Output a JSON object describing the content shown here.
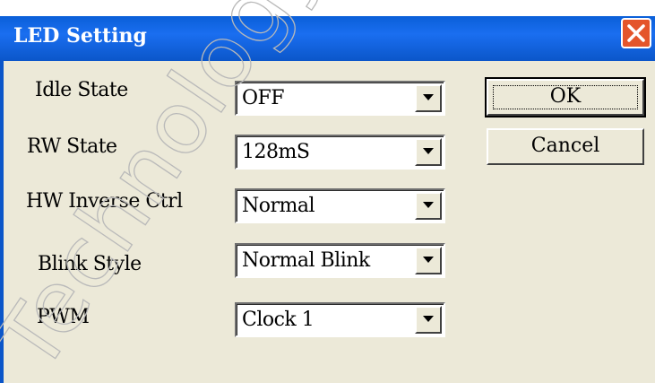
{
  "dialog": {
    "title": "LED Setting",
    "close_icon": "close-icon"
  },
  "fields": [
    {
      "label": "Idle State",
      "value": "OFF"
    },
    {
      "label": "RW State",
      "value": "128mS"
    },
    {
      "label": "HW Inverse Ctrl",
      "value": "Normal"
    },
    {
      "label": "Blink Style",
      "value": "Normal Blink"
    },
    {
      "label": "PWM",
      "value": "Clock 1"
    }
  ],
  "buttons": {
    "ok_label": "OK",
    "cancel_label": "Cancel"
  },
  "watermark": {
    "text": "Technology"
  },
  "colors": {
    "titlebar": "#0b56c9",
    "close": "#e4552b",
    "client": "#ece9d8"
  }
}
